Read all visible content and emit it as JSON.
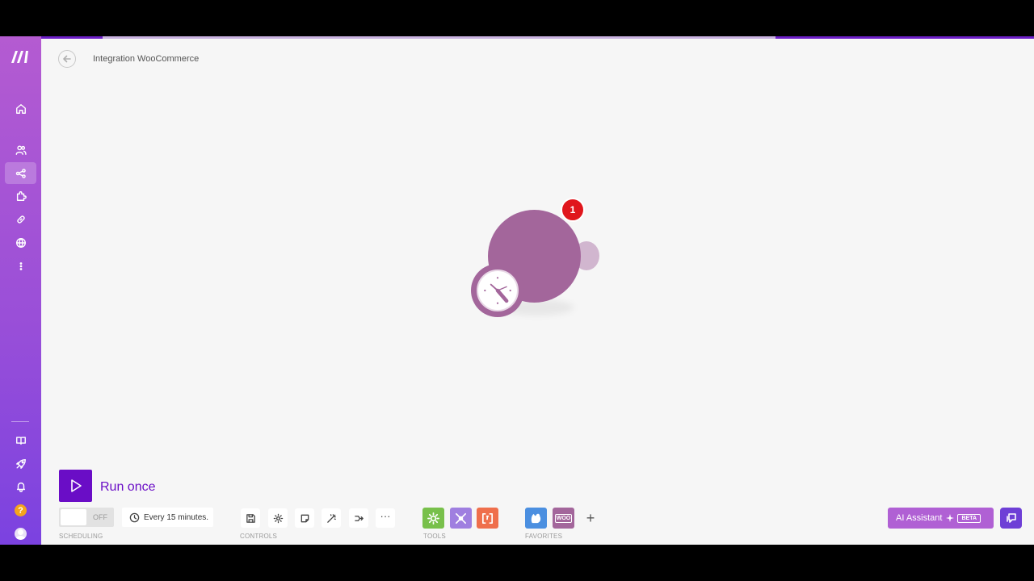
{
  "header": {
    "title": "Integration WooCommerce"
  },
  "sidebar": {
    "items": [
      {
        "icon": "home-icon"
      },
      {
        "icon": "team-icon"
      },
      {
        "icon": "scenarios-icon",
        "active": true
      },
      {
        "icon": "apps-icon"
      },
      {
        "icon": "connections-icon"
      },
      {
        "icon": "webhooks-icon"
      },
      {
        "icon": "more-icon"
      }
    ],
    "bottom_items": [
      {
        "icon": "book-icon"
      },
      {
        "icon": "rocket-icon"
      },
      {
        "icon": "bell-icon"
      },
      {
        "icon": "help-icon",
        "text": "?"
      },
      {
        "icon": "avatar-icon"
      }
    ]
  },
  "module": {
    "badge": "1",
    "color": "#a3669b"
  },
  "run": {
    "label": "Run once"
  },
  "scheduling": {
    "toggle_state": "OFF",
    "interval": "Every 15 minutes.",
    "section_label": "SCHEDULING"
  },
  "controls": {
    "section_label": "CONTROLS",
    "items": [
      "save-icon",
      "settings-icon",
      "notes-icon",
      "auto-align-icon",
      "explain-flow-icon",
      "more-icon"
    ]
  },
  "tools": {
    "section_label": "TOOLS",
    "items": [
      {
        "icon": "tools-gear-icon",
        "color": "#78c04b"
      },
      {
        "icon": "flow-control-icon",
        "color": "#9f7fe0"
      },
      {
        "icon": "text-parser-icon",
        "color": "#ef6f4c"
      }
    ]
  },
  "favorites": {
    "section_label": "FAVORITES",
    "items": [
      {
        "icon": "ai-app-icon",
        "color": "#4b8fe0"
      },
      {
        "icon": "woocommerce-icon",
        "color": "#a3669b",
        "text": "WOO"
      }
    ]
  },
  "assistant": {
    "label": "AI Assistant",
    "beta": "BETA"
  },
  "colors": {
    "brand": "#6a0dc6",
    "badge": "#e0161c"
  }
}
